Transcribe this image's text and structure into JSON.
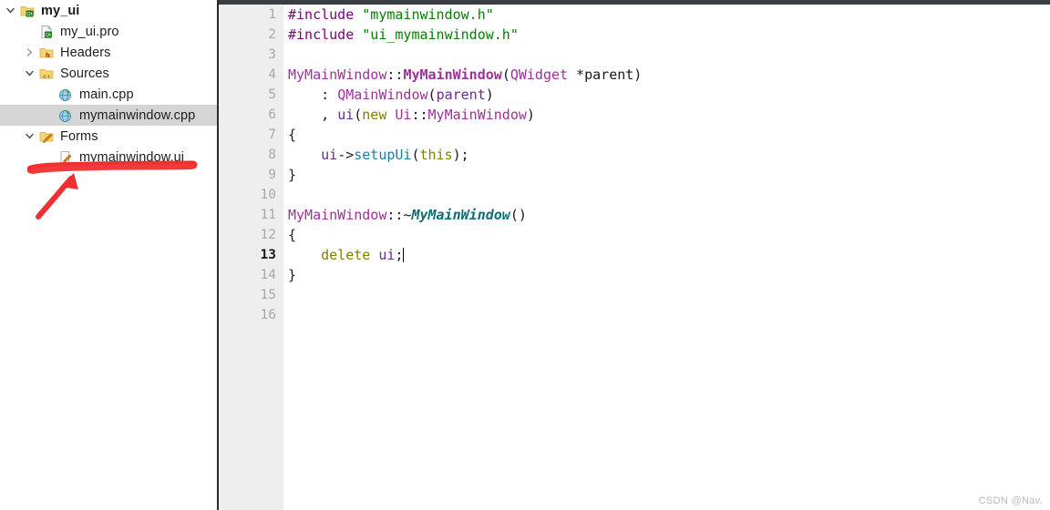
{
  "window": {
    "title": "Qt Creator Project Tree and Editor"
  },
  "sidebar": {
    "name": "project-tree",
    "items": [
      {
        "label": "my_ui",
        "icon": "qt-project-folder-icon",
        "twisty": "chevron-down",
        "indent": 0,
        "bold": true,
        "selected": false
      },
      {
        "label": "my_ui.pro",
        "icon": "qt-pro-file-icon",
        "twisty": "none",
        "indent": 1,
        "bold": false,
        "selected": false
      },
      {
        "label": "Headers",
        "icon": "headers-folder-icon",
        "twisty": "chevron-right",
        "indent": 1,
        "bold": false,
        "selected": false
      },
      {
        "label": "Sources",
        "icon": "sources-folder-icon",
        "twisty": "chevron-down",
        "indent": 1,
        "bold": false,
        "selected": false
      },
      {
        "label": "main.cpp",
        "icon": "cpp-file-icon",
        "twisty": "none",
        "indent": 2,
        "bold": false,
        "selected": false
      },
      {
        "label": "mymainwindow.cpp",
        "icon": "cpp-file-icon",
        "twisty": "none",
        "indent": 2,
        "bold": false,
        "selected": true
      },
      {
        "label": "Forms",
        "icon": "forms-folder-icon",
        "twisty": "chevron-down",
        "indent": 1,
        "bold": false,
        "selected": false
      },
      {
        "label": "mymainwindow.ui",
        "icon": "ui-file-icon",
        "twisty": "none",
        "indent": 2,
        "bold": false,
        "selected": false
      }
    ]
  },
  "annotation": {
    "name": "red-arrow-annotation",
    "color": "#f03030",
    "description": "red underline under mymainwindow.ui with arrow pointing to it"
  },
  "editor": {
    "name": "code-editor",
    "file": "mymainwindow.cpp",
    "current_line": 13,
    "total_lines": 16,
    "fold_markers": [
      6,
      11
    ],
    "colors": {
      "background": "#ffffff",
      "gutter_background": "#eeeeee",
      "gutter_text": "#a8a8a8",
      "preprocessor": "#800080",
      "string": "#008000",
      "type": "#a0309a",
      "keyword": "#808000",
      "variable": "#6a2c8a",
      "function": "#1a7fa8",
      "destructor": "#0b6f77",
      "plain": "#1a1a1a"
    },
    "lines": [
      {
        "n": 1,
        "tokens": [
          {
            "t": "#include",
            "c": "t-pre"
          },
          {
            "t": " ",
            "c": "t-plain"
          },
          {
            "t": "\"mymainwindow.h\"",
            "c": "t-str"
          }
        ]
      },
      {
        "n": 2,
        "tokens": [
          {
            "t": "#include",
            "c": "t-pre"
          },
          {
            "t": " ",
            "c": "t-plain"
          },
          {
            "t": "\"ui_mymainwindow.h\"",
            "c": "t-str"
          }
        ]
      },
      {
        "n": 3,
        "tokens": []
      },
      {
        "n": 4,
        "tokens": [
          {
            "t": "MyMainWindow",
            "c": "t-type"
          },
          {
            "t": "::",
            "c": "t-plain"
          },
          {
            "t": "MyMainWindow",
            "c": "t-typeb"
          },
          {
            "t": "(",
            "c": "t-plain"
          },
          {
            "t": "QWidget",
            "c": "t-type"
          },
          {
            "t": " *parent)",
            "c": "t-plain"
          }
        ]
      },
      {
        "n": 5,
        "tokens": [
          {
            "t": "    : ",
            "c": "t-plain"
          },
          {
            "t": "QMainWindow",
            "c": "t-type"
          },
          {
            "t": "(",
            "c": "t-plain"
          },
          {
            "t": "parent",
            "c": "t-var"
          },
          {
            "t": ")",
            "c": "t-plain"
          }
        ]
      },
      {
        "n": 6,
        "tokens": [
          {
            "t": "    , ",
            "c": "t-plain"
          },
          {
            "t": "ui",
            "c": "t-var"
          },
          {
            "t": "(",
            "c": "t-plain"
          },
          {
            "t": "new",
            "c": "t-kw"
          },
          {
            "t": " ",
            "c": "t-plain"
          },
          {
            "t": "Ui",
            "c": "t-type"
          },
          {
            "t": "::",
            "c": "t-plain"
          },
          {
            "t": "MyMainWindow",
            "c": "t-type"
          },
          {
            "t": ")",
            "c": "t-plain"
          }
        ]
      },
      {
        "n": 7,
        "tokens": [
          {
            "t": "{",
            "c": "t-plain"
          }
        ]
      },
      {
        "n": 8,
        "tokens": [
          {
            "t": "    ",
            "c": "t-plain"
          },
          {
            "t": "ui",
            "c": "t-var"
          },
          {
            "t": "->",
            "c": "t-plain"
          },
          {
            "t": "setupUi",
            "c": "t-fn"
          },
          {
            "t": "(",
            "c": "t-plain"
          },
          {
            "t": "this",
            "c": "t-kw"
          },
          {
            "t": ");",
            "c": "t-plain"
          }
        ]
      },
      {
        "n": 9,
        "tokens": [
          {
            "t": "}",
            "c": "t-plain"
          }
        ]
      },
      {
        "n": 10,
        "tokens": []
      },
      {
        "n": 11,
        "tokens": [
          {
            "t": "MyMainWindow",
            "c": "t-type"
          },
          {
            "t": "::~",
            "c": "t-plain"
          },
          {
            "t": "MyMainWindow",
            "c": "t-dtor"
          },
          {
            "t": "()",
            "c": "t-plain"
          }
        ]
      },
      {
        "n": 12,
        "tokens": [
          {
            "t": "{",
            "c": "t-plain"
          }
        ]
      },
      {
        "n": 13,
        "tokens": [
          {
            "t": "    ",
            "c": "t-plain"
          },
          {
            "t": "delete",
            "c": "t-kw"
          },
          {
            "t": " ",
            "c": "t-plain"
          },
          {
            "t": "ui",
            "c": "t-var"
          },
          {
            "t": ";",
            "c": "t-plain"
          }
        ],
        "caret": true
      },
      {
        "n": 14,
        "tokens": [
          {
            "t": "}",
            "c": "t-plain"
          }
        ]
      },
      {
        "n": 15,
        "tokens": []
      },
      {
        "n": 16,
        "tokens": []
      }
    ]
  },
  "watermark": {
    "text": "CSDN @Nav."
  }
}
